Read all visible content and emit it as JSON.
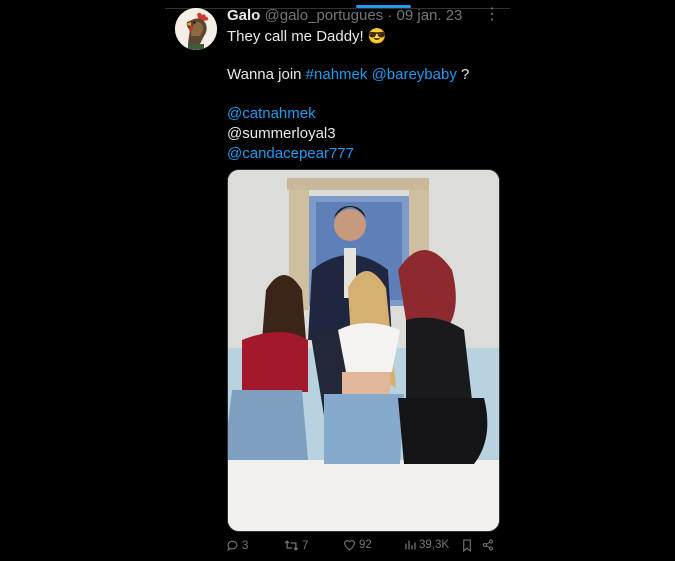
{
  "tweet": {
    "display_name": "Galo",
    "handle": "@galo_portugues",
    "separator": "·",
    "date": "09 jan. 23",
    "line1": "They call me Daddy!",
    "emoji": "😎",
    "line2_prefix": "Wanna join",
    "hashtag": "#nahmek",
    "mention1": "@bareybaby",
    "line2_suffix": "?",
    "mention2": "@catnahmek",
    "mention3": "@summerloyal3",
    "mention4": "@candacepear777"
  },
  "actions": {
    "replies": "3",
    "retweets": "7",
    "likes": "92",
    "views": "39,3K"
  },
  "colors": {
    "background": "#000000",
    "link": "#1d9bf0",
    "muted": "#71767b",
    "text": "#e7e9ea"
  },
  "icons": [
    "rooster-avatar",
    "more-icon",
    "reply-icon",
    "retweet-icon",
    "like-icon",
    "views-icon",
    "bookmark-icon",
    "share-icon"
  ]
}
